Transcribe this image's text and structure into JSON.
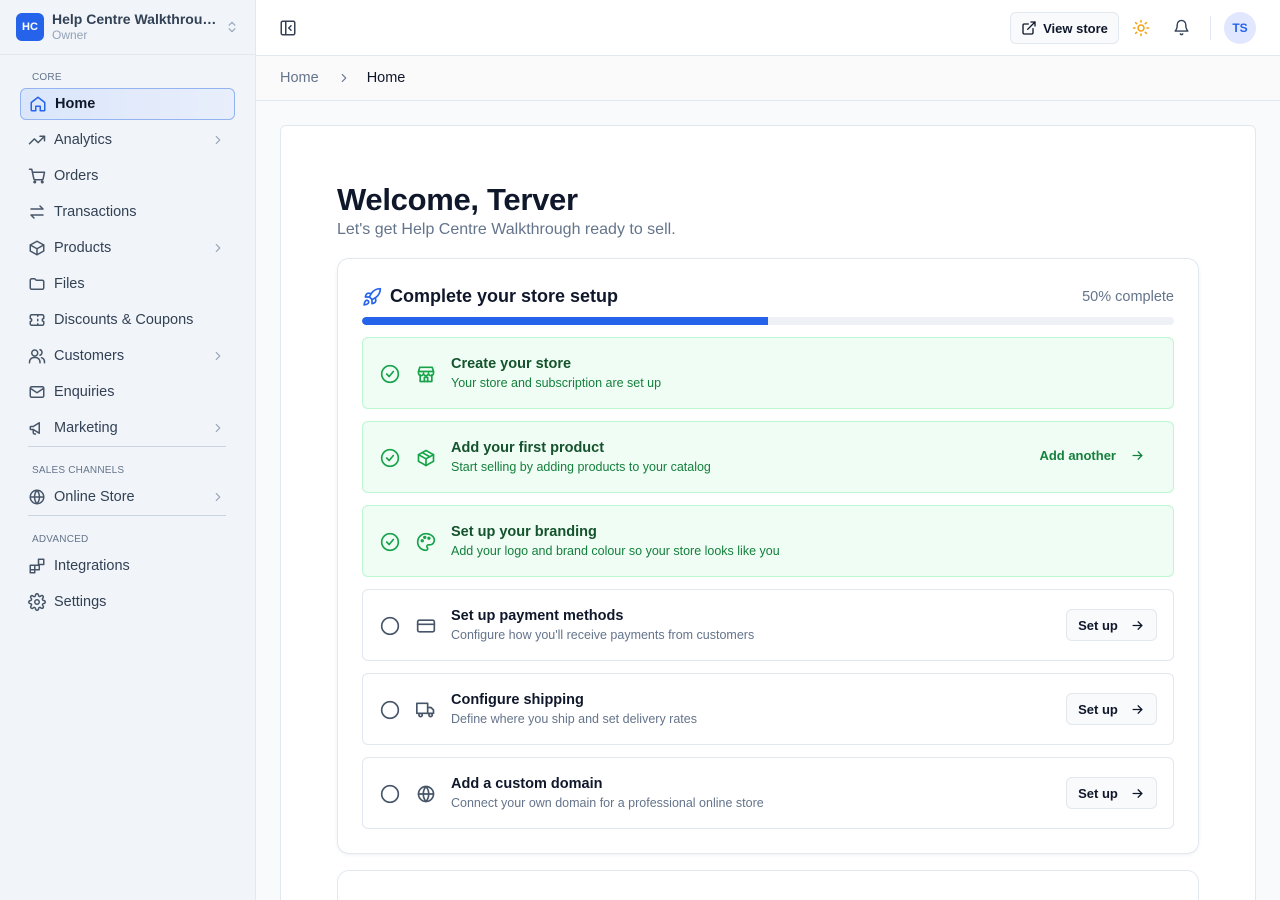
{
  "store": {
    "logo_initials": "HC",
    "name": "Help Centre Walkthrough",
    "role": "Owner"
  },
  "sidebar": {
    "sections": {
      "core": "CORE",
      "sales_channels": "SALES CHANNELS",
      "advanced": "ADVANCED"
    },
    "items": [
      {
        "label": "Home",
        "icon": "home-icon",
        "active": true,
        "has_submenu": false
      },
      {
        "label": "Analytics",
        "icon": "trending-up-icon",
        "has_submenu": true
      },
      {
        "label": "Orders",
        "icon": "cart-icon",
        "has_submenu": false
      },
      {
        "label": "Transactions",
        "icon": "arrows-swap-icon",
        "has_submenu": false
      },
      {
        "label": "Products",
        "icon": "box-icon",
        "has_submenu": true
      },
      {
        "label": "Files",
        "icon": "folder-icon",
        "has_submenu": false
      },
      {
        "label": "Discounts & Coupons",
        "icon": "ticket-icon",
        "has_submenu": false
      },
      {
        "label": "Customers",
        "icon": "users-icon",
        "has_submenu": true
      },
      {
        "label": "Enquiries",
        "icon": "mail-icon",
        "has_submenu": false
      },
      {
        "label": "Marketing",
        "icon": "megaphone-icon",
        "has_submenu": true
      },
      {
        "label": "Online Store",
        "icon": "globe-icon",
        "has_submenu": true
      },
      {
        "label": "Integrations",
        "icon": "blocks-icon",
        "has_submenu": false
      },
      {
        "label": "Settings",
        "icon": "gear-icon",
        "has_submenu": false
      }
    ]
  },
  "header": {
    "view_store_label": "View store",
    "avatar_initials": "TS"
  },
  "breadcrumb": {
    "root": "Home",
    "current": "Home"
  },
  "main": {
    "welcome": "Welcome, Terver",
    "subtitle": "Let's get Help Centre Walkthrough ready to sell."
  },
  "setup": {
    "title": "Complete your store setup",
    "progress_label": "50% complete",
    "progress": 0.5,
    "accent_color": "#2563eb",
    "done_color": "#16a34a",
    "tasks": [
      {
        "title": "Create your store",
        "desc": "Your store and subscription are set up",
        "done": true,
        "icon": "store-icon"
      },
      {
        "title": "Add your first product",
        "desc": "Start selling by adding products to your catalog",
        "done": true,
        "icon": "box-icon",
        "action": "Add another"
      },
      {
        "title": "Set up your branding",
        "desc": "Add your logo and brand colour so your store looks like you",
        "done": true,
        "icon": "palette-icon"
      },
      {
        "title": "Set up payment methods",
        "desc": "Configure how you'll receive payments from customers",
        "done": false,
        "icon": "credit-card-icon",
        "action": "Set up"
      },
      {
        "title": "Configure shipping",
        "desc": "Define where you ship and set delivery rates",
        "done": false,
        "icon": "truck-icon",
        "action": "Set up"
      },
      {
        "title": "Add a custom domain",
        "desc": "Connect your own domain for a professional online store",
        "done": false,
        "icon": "globe-icon",
        "action": "Set up"
      }
    ]
  }
}
